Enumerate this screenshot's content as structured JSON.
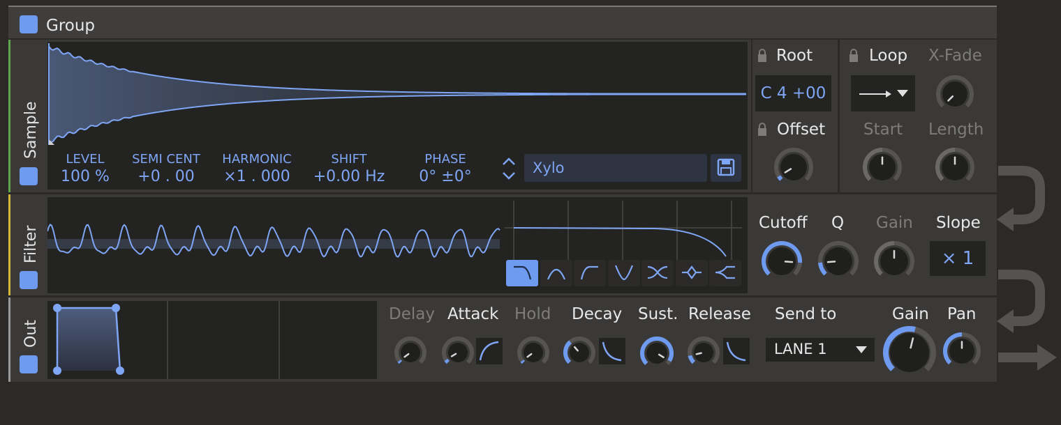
{
  "group": {
    "title": "Group"
  },
  "sections": {
    "sample": "Sample",
    "filter": "Filter",
    "out": "Out"
  },
  "sample": {
    "params": [
      {
        "label": "LEVEL",
        "value": "100 %"
      },
      {
        "label": "SEMI CENT",
        "value": "+0 . 00"
      },
      {
        "label": "HARMONIC",
        "value": "×1 . 000"
      },
      {
        "label": "SHIFT",
        "value": "+0.00 Hz"
      },
      {
        "label": "PHASE",
        "value": "0° ±0°"
      }
    ],
    "preset_name": "Xylo",
    "root_label": "Root",
    "root_value": "C  4 +00",
    "offset_label": "Offset",
    "loop_label": "Loop",
    "xfade_label": "X-Fade",
    "start_label": "Start",
    "length_label": "Length"
  },
  "filter": {
    "cutoff_label": "Cutoff",
    "q_label": "Q",
    "gain_label": "Gain",
    "slope_label": "Slope",
    "slope_value": "× 1",
    "cutoff_level": 0.85,
    "q_level": 0.15,
    "types": [
      "lowpass-icon",
      "bandpass-icon",
      "highpass-icon",
      "notch-icon",
      "allpass-icon",
      "peak-icon",
      "shelf-icon"
    ]
  },
  "out": {
    "delay_label": "Delay",
    "attack_label": "Attack",
    "hold_label": "Hold",
    "decay_label": "Decay",
    "sustain_label": "Sust.",
    "release_label": "Release",
    "sendto_label": "Send to",
    "sendto_value": "LANE 1",
    "gain_label": "Gain",
    "pan_label": "Pan",
    "gain_level": 0.55,
    "sustain_level": 0.95
  },
  "colors": {
    "accent": "#6e9af0",
    "sample_band": "#5fa84a",
    "filter_band": "#d6b83a",
    "out_band": "#9a9a9a"
  }
}
